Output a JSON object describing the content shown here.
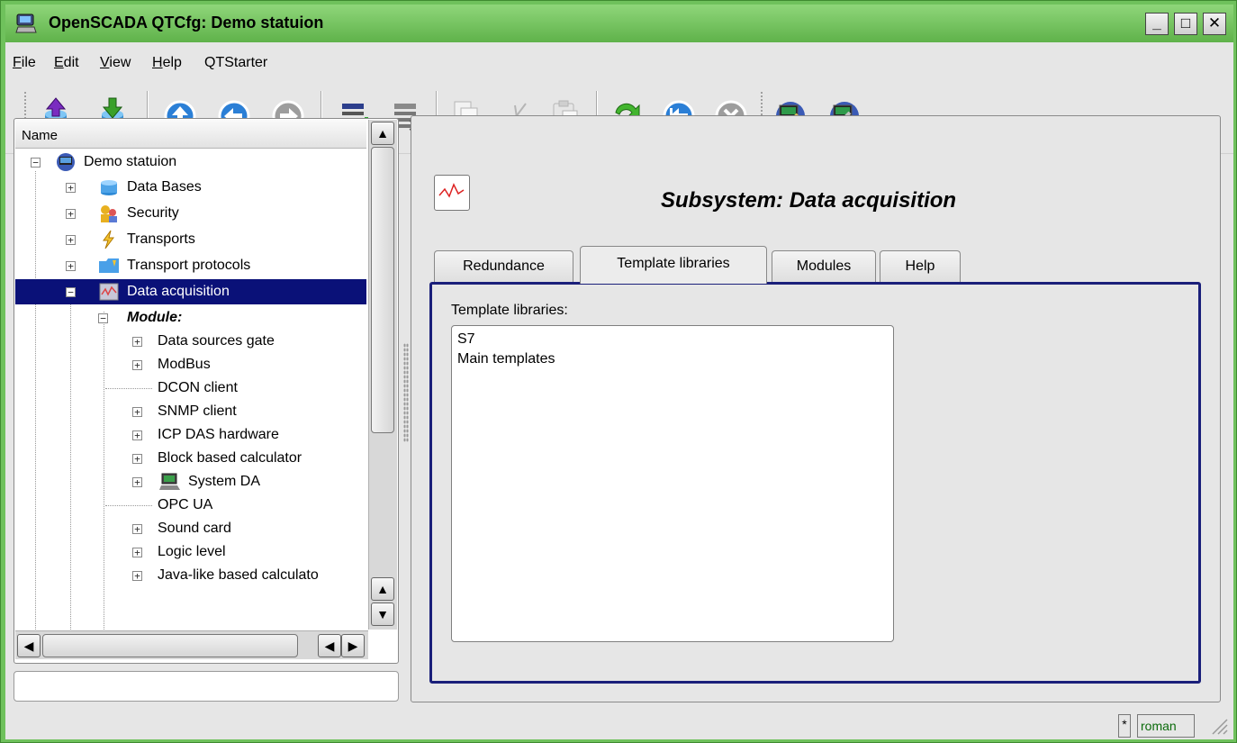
{
  "window": {
    "title": "OpenSCADA QTCfg: Demo statuion",
    "controls": {
      "minimize": "_",
      "maximize": "□",
      "close": "✕"
    }
  },
  "menu": [
    {
      "label": "File",
      "underline": "F",
      "rest": "ile"
    },
    {
      "label": "Edit",
      "underline": "E",
      "rest": "dit"
    },
    {
      "label": "View",
      "underline": "V",
      "rest": "iew"
    },
    {
      "label": "Help",
      "underline": "H",
      "rest": "elp"
    },
    {
      "label": "QTStarter",
      "underline": "",
      "rest": "QTStarter"
    }
  ],
  "toolbar": {
    "icons": [
      "db-load-icon",
      "db-save-icon",
      "up-icon",
      "back-icon",
      "forward-icon",
      "add-item-icon",
      "delete-item-icon",
      "copy-icon",
      "cut-icon",
      "paste-icon",
      "refresh-icon",
      "start-icon",
      "stop-icon",
      "station-connect-icon",
      "station-settings-icon"
    ]
  },
  "tree": {
    "header": "Name",
    "items": [
      {
        "label": "Demo statuion",
        "icon": "station-icon",
        "depth": 0,
        "expander": "−"
      },
      {
        "label": "Data Bases",
        "icon": "database-icon",
        "depth": 1,
        "expander": "+"
      },
      {
        "label": "Security",
        "icon": "security-icon",
        "depth": 1,
        "expander": "+"
      },
      {
        "label": "Transports",
        "icon": "lightning-icon",
        "depth": 1,
        "expander": "+"
      },
      {
        "label": "Transport protocols",
        "icon": "folder-icon",
        "depth": 1,
        "expander": "+"
      },
      {
        "label": "Data acquisition",
        "icon": "chart-icon",
        "depth": 1,
        "expander": "−",
        "selected": true
      },
      {
        "label": "Module:",
        "icon": "",
        "depth": 2,
        "expander": "−",
        "italic": true
      },
      {
        "label": "Data sources gate",
        "icon": "",
        "depth": 3,
        "expander": "+"
      },
      {
        "label": "ModBus",
        "icon": "",
        "depth": 3,
        "expander": "+"
      },
      {
        "label": "DCON client",
        "icon": "",
        "depth": 3,
        "expander": ""
      },
      {
        "label": "SNMP client",
        "icon": "",
        "depth": 3,
        "expander": "+"
      },
      {
        "label": "ICP DAS hardware",
        "icon": "",
        "depth": 3,
        "expander": "+"
      },
      {
        "label": "Block based calculator",
        "icon": "",
        "depth": 3,
        "expander": "+"
      },
      {
        "label": "System DA",
        "icon": "computer-icon",
        "depth": 3,
        "expander": "+"
      },
      {
        "label": "OPC UA",
        "icon": "",
        "depth": 3,
        "expander": ""
      },
      {
        "label": "Sound card",
        "icon": "",
        "depth": 3,
        "expander": "+"
      },
      {
        "label": "Logic level",
        "icon": "",
        "depth": 3,
        "expander": "+"
      },
      {
        "label": "Java-like based calculato",
        "icon": "",
        "depth": 3,
        "expander": "+"
      }
    ]
  },
  "main": {
    "title": "Subsystem: Data acquisition",
    "tabs": [
      {
        "label": "Redundance",
        "active": false
      },
      {
        "label": "Template libraries",
        "active": true
      },
      {
        "label": "Modules",
        "active": false
      },
      {
        "label": "Help",
        "active": false
      }
    ],
    "panel_label": "Template libraries:",
    "libraries": [
      "S7",
      "Main templates"
    ]
  },
  "statusbar": {
    "modified_marker": "*",
    "user": "roman"
  },
  "colors": {
    "selection": "#0a1178",
    "tab_frame": "#1a1f7a",
    "window_frame": "#6fc15c",
    "user_text": "#0a6a0a"
  }
}
